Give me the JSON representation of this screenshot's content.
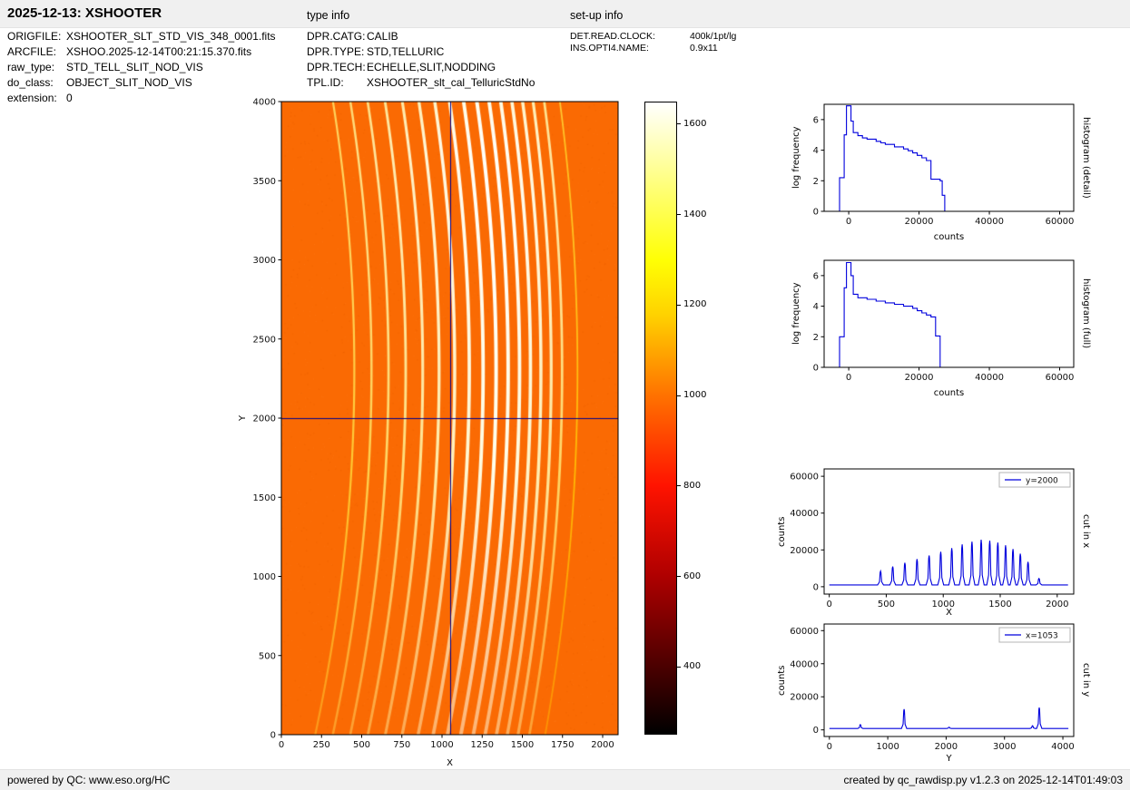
{
  "header": {
    "title": "2025-12-13: XSHOOTER",
    "type_info_label": "type info",
    "setup_info_label": "set-up info"
  },
  "metadata": {
    "left": [
      {
        "label": "ORIGFILE:",
        "value": "XSHOOTER_SLT_STD_VIS_348_0001.fits"
      },
      {
        "label": "ARCFILE:",
        "value": "XSHOO.2025-12-14T00:21:15.370.fits"
      },
      {
        "label": "raw_type:",
        "value": "STD_TELL_SLIT_NOD_VIS"
      },
      {
        "label": "do_class:",
        "value": "OBJECT_SLIT_NOD_VIS"
      },
      {
        "label": "extension:",
        "value": "0"
      }
    ],
    "type_info": [
      {
        "label": "DPR.CATG:",
        "value": "CALIB"
      },
      {
        "label": "DPR.TYPE:",
        "value": "STD,TELLURIC"
      },
      {
        "label": "DPR.TECH:",
        "value": "ECHELLE,SLIT,NODDING"
      },
      {
        "label": "TPL.ID:",
        "value": "XSHOOTER_slt_cal_TelluricStdNo"
      }
    ],
    "setup_info": [
      {
        "label": "DET.READ.CLOCK:",
        "value": "400k/1pt/lg"
      },
      {
        "label": "INS.OPTI4.NAME:",
        "value": "0.9x11"
      }
    ]
  },
  "footer": {
    "left": "powered by QC: www.eso.org/HC",
    "right": "created by qc_rawdisp.py v1.2.3 on 2025-12-14T01:49:03"
  },
  "chart_data": [
    {
      "id": "raw-image",
      "type": "heatmap",
      "xlabel": "X",
      "ylabel": "Y",
      "xlim": [
        0,
        2096
      ],
      "ylim": [
        0,
        4000
      ],
      "xticks": [
        0,
        250,
        500,
        750,
        1000,
        1250,
        1500,
        1750,
        2000
      ],
      "yticks": [
        0,
        500,
        1000,
        1500,
        2000,
        2500,
        3000,
        3500,
        4000
      ],
      "background_counts": 1020,
      "background_color": "#fa6a03",
      "orders": {
        "x_at_y2000": [
          450,
          557,
          663,
          770,
          876,
          978,
          1075,
          1166,
          1252,
          1333,
          1408,
          1479,
          1547,
          1612,
          1676,
          1744,
          1840
        ],
        "peak_counts": [
          8500,
          11000,
          13000,
          15000,
          17000,
          19000,
          21000,
          23000,
          24500,
          25500,
          25000,
          24000,
          22500,
          20500,
          18000,
          13500,
          4500
        ],
        "apex_y": 2300,
        "curvature_k": 42
      },
      "crosshair": {
        "x": 1053,
        "y": 2000,
        "color": "#00008b"
      },
      "colorbar": {
        "vmin": 250,
        "vmax": 1650,
        "ticks": [
          400,
          600,
          800,
          1000,
          1200,
          1400,
          1600
        ],
        "colormap": "hot",
        "gradient": [
          {
            "pos": 0.0,
            "color": "#ffffff"
          },
          {
            "pos": 0.107,
            "color": "#ffff93"
          },
          {
            "pos": 0.25,
            "color": "#ffff04"
          },
          {
            "pos": 0.336,
            "color": "#ffd200"
          },
          {
            "pos": 0.464,
            "color": "#ff7200"
          },
          {
            "pos": 0.607,
            "color": "#ff1300"
          },
          {
            "pos": 0.75,
            "color": "#af0000"
          },
          {
            "pos": 0.893,
            "color": "#4b0000"
          },
          {
            "pos": 1.0,
            "color": "#000000"
          }
        ]
      }
    },
    {
      "id": "histogram-detail",
      "type": "line",
      "side_label": "histogram (detail)",
      "xlabel": "counts",
      "ylabel": "log frequency",
      "xlim": [
        -7000,
        64000
      ],
      "ylim": [
        0,
        7
      ],
      "xticks": [
        0,
        20000,
        40000,
        60000
      ],
      "yticks": [
        0,
        2,
        4,
        6
      ],
      "line_color": "#0000dd",
      "points": [
        [
          -2600,
          0
        ],
        [
          -2600,
          2.2
        ],
        [
          -1300,
          2.2
        ],
        [
          -1300,
          5.0
        ],
        [
          -650,
          5.0
        ],
        [
          -650,
          6.9
        ],
        [
          650,
          6.9
        ],
        [
          650,
          5.9
        ],
        [
          1300,
          5.9
        ],
        [
          1300,
          5.15
        ],
        [
          2600,
          5.15
        ],
        [
          2600,
          4.95
        ],
        [
          3900,
          4.95
        ],
        [
          3900,
          4.8
        ],
        [
          5200,
          4.8
        ],
        [
          5200,
          4.72
        ],
        [
          7800,
          4.72
        ],
        [
          7800,
          4.58
        ],
        [
          9100,
          4.58
        ],
        [
          9100,
          4.48
        ],
        [
          10400,
          4.48
        ],
        [
          10400,
          4.38
        ],
        [
          13000,
          4.38
        ],
        [
          13000,
          4.22
        ],
        [
          15600,
          4.22
        ],
        [
          15600,
          4.08
        ],
        [
          16900,
          4.08
        ],
        [
          16900,
          3.96
        ],
        [
          18200,
          3.96
        ],
        [
          18200,
          3.82
        ],
        [
          19500,
          3.82
        ],
        [
          19500,
          3.66
        ],
        [
          20800,
          3.66
        ],
        [
          20800,
          3.5
        ],
        [
          22100,
          3.5
        ],
        [
          22100,
          3.32
        ],
        [
          23400,
          3.32
        ],
        [
          23400,
          2.1
        ],
        [
          26000,
          2.1
        ],
        [
          26000,
          2.0
        ],
        [
          26600,
          2.0
        ],
        [
          26600,
          1.05
        ],
        [
          27300,
          1.05
        ],
        [
          27300,
          0
        ]
      ]
    },
    {
      "id": "histogram-full",
      "type": "line",
      "side_label": "histogram (full)",
      "xlabel": "counts",
      "ylabel": "log frequency",
      "xlim": [
        -7000,
        64000
      ],
      "ylim": [
        0,
        7
      ],
      "xticks": [
        0,
        20000,
        40000,
        60000
      ],
      "yticks": [
        0,
        2,
        4,
        6
      ],
      "line_color": "#0000dd",
      "points": [
        [
          -2600,
          0
        ],
        [
          -2600,
          2.0
        ],
        [
          -1300,
          2.0
        ],
        [
          -1300,
          5.2
        ],
        [
          -650,
          5.2
        ],
        [
          -650,
          6.85
        ],
        [
          650,
          6.85
        ],
        [
          650,
          6.0
        ],
        [
          1300,
          6.0
        ],
        [
          1300,
          4.78
        ],
        [
          2600,
          4.78
        ],
        [
          2600,
          4.55
        ],
        [
          5200,
          4.55
        ],
        [
          5200,
          4.45
        ],
        [
          7800,
          4.45
        ],
        [
          7800,
          4.33
        ],
        [
          10400,
          4.33
        ],
        [
          10400,
          4.22
        ],
        [
          13000,
          4.22
        ],
        [
          13000,
          4.12
        ],
        [
          15600,
          4.12
        ],
        [
          15600,
          4.0
        ],
        [
          18200,
          4.0
        ],
        [
          18200,
          3.86
        ],
        [
          19500,
          3.86
        ],
        [
          19500,
          3.7
        ],
        [
          20800,
          3.7
        ],
        [
          20800,
          3.56
        ],
        [
          22100,
          3.56
        ],
        [
          22100,
          3.42
        ],
        [
          23400,
          3.42
        ],
        [
          23400,
          3.3
        ],
        [
          24700,
          3.3
        ],
        [
          24700,
          2.05
        ],
        [
          26000,
          2.05
        ],
        [
          26000,
          0
        ]
      ]
    },
    {
      "id": "cut-in-x",
      "type": "line",
      "side_label": "cut in x",
      "legend": "y=2000",
      "xlabel": "X",
      "ylabel": "counts",
      "xlim": [
        -45,
        2145
      ],
      "ylim": [
        -4000,
        64000
      ],
      "xticks": [
        0,
        500,
        1000,
        1500,
        2000
      ],
      "yticks": [
        0,
        20000,
        40000,
        60000
      ],
      "line_color": "#0000dd",
      "baseline": 1000,
      "peak_halfwidth": 8,
      "data_xmax": 2095,
      "peaks": [
        [
          450,
          8500
        ],
        [
          557,
          11000
        ],
        [
          663,
          13000
        ],
        [
          770,
          15000
        ],
        [
          876,
          17000
        ],
        [
          978,
          19000
        ],
        [
          1075,
          21000
        ],
        [
          1166,
          23000
        ],
        [
          1252,
          24500
        ],
        [
          1333,
          25500
        ],
        [
          1408,
          25000
        ],
        [
          1479,
          24000
        ],
        [
          1547,
          22500
        ],
        [
          1612,
          20500
        ],
        [
          1676,
          18000
        ],
        [
          1744,
          13500
        ],
        [
          1840,
          4500
        ]
      ]
    },
    {
      "id": "cut-in-y",
      "type": "line",
      "side_label": "cut in y",
      "legend": "x=1053",
      "xlabel": "Y",
      "ylabel": "counts",
      "xlim": [
        -90,
        4186
      ],
      "ylim": [
        -4000,
        64000
      ],
      "xticks": [
        0,
        1000,
        2000,
        3000,
        4000
      ],
      "yticks": [
        0,
        20000,
        40000,
        60000
      ],
      "line_color": "#0000dd",
      "baseline": 850,
      "peak_halfwidth": 14,
      "data_xmax": 4095,
      "peaks": [
        [
          530,
          3200
        ],
        [
          1280,
          12500
        ],
        [
          2050,
          1600
        ],
        [
          3480,
          2500
        ],
        [
          3595,
          13500
        ]
      ]
    }
  ]
}
